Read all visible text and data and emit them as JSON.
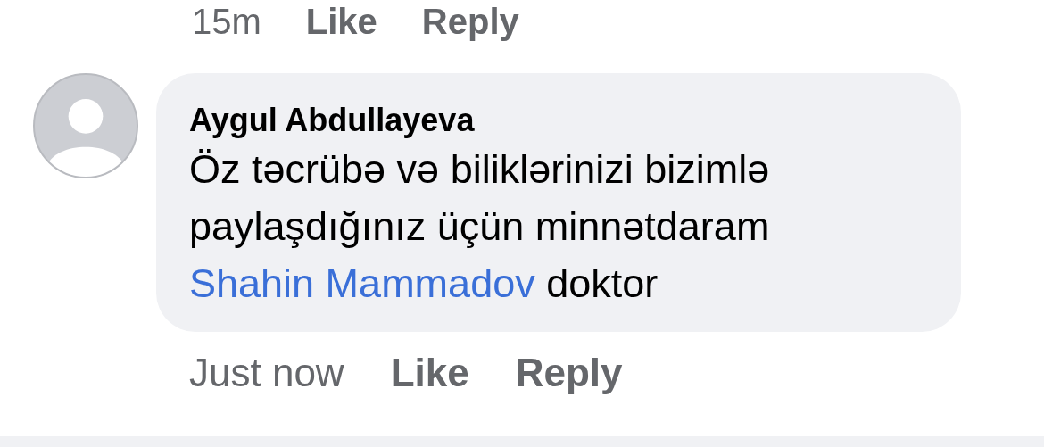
{
  "previous_comment_actions": {
    "time": "15m",
    "like": "Like",
    "reply": "Reply"
  },
  "comment": {
    "author": "Aygul Abdullayeva",
    "text": "Öz təcrübə və biliklərinizi bizimlə paylaşdığınız üçün minnətdaram",
    "mention": "Shahin Mammadov",
    "text_after": "doktor",
    "time": "Just now",
    "like": "Like",
    "reply": "Reply"
  }
}
